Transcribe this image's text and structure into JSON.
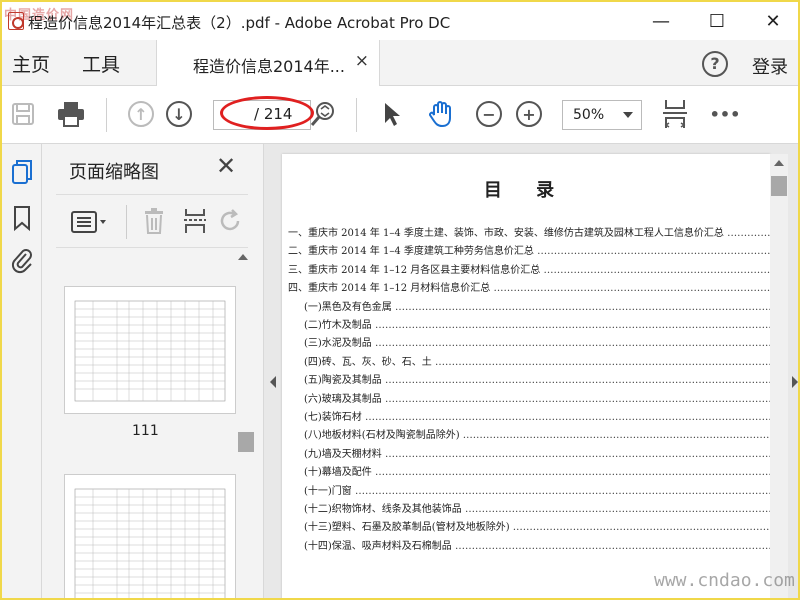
{
  "watermark_top": "中国造价网",
  "watermark_bottom": "www.cndao.com",
  "window": {
    "title": "程造价信息2014年汇总表（2）.pdf - Adobe Acrobat Pro DC",
    "minimize": "—",
    "maximize": "☐",
    "close": "✕"
  },
  "menubar": {
    "home": "主页",
    "tools": "工具",
    "tab_label": "程造价信息2014年...",
    "tab_close": "×",
    "help": "?",
    "login": "登录"
  },
  "toolbar": {
    "page_current": "",
    "page_total": "/ 214",
    "zoom": "50%",
    "more": "•••"
  },
  "thumbnails": {
    "title": "页面缩略图",
    "close": "✕",
    "page_labels": [
      "111"
    ]
  },
  "document": {
    "toc_title": "目 录",
    "toc_items": [
      {
        "text": "一、重庆市 2014 年 1–4 季度土建、装饰、市政、安装、维修仿古建筑及园林工程人工信息价汇总",
        "indent": false
      },
      {
        "text": "二、重庆市 2014 年 1–4 季度建筑工种劳务信息价汇总",
        "indent": false
      },
      {
        "text": "三、重庆市 2014 年 1–12 月各区县主要材料信息价汇总",
        "indent": false
      },
      {
        "text": "四、重庆市 2014 年 1–12 月材料信息价汇总",
        "indent": false
      },
      {
        "text": "(一)黑色及有色金属",
        "indent": true
      },
      {
        "text": "(二)竹木及制品",
        "indent": true
      },
      {
        "text": "(三)水泥及制品",
        "indent": true
      },
      {
        "text": "(四)砖、瓦、灰、砂、石、土",
        "indent": true
      },
      {
        "text": "(五)陶瓷及其制品",
        "indent": true
      },
      {
        "text": "(六)玻璃及其制品",
        "indent": true
      },
      {
        "text": "(七)装饰石材",
        "indent": true
      },
      {
        "text": "(八)地板材料(石材及陶瓷制品除外)",
        "indent": true
      },
      {
        "text": "(九)墙及天棚材料",
        "indent": true
      },
      {
        "text": "(十)幕墙及配件",
        "indent": true
      },
      {
        "text": "(十一)门窗",
        "indent": true
      },
      {
        "text": "(十二)织物饰材、线条及其他装饰品",
        "indent": true
      },
      {
        "text": "(十三)塑料、石墨及胶革制品(管材及地板除外)",
        "indent": true
      },
      {
        "text": "(十四)保温、吸声材料及石棉制品",
        "indent": true
      }
    ]
  },
  "colors": {
    "highlight_ellipse": "#e02020",
    "hand_tool": "#1a6fd1",
    "rail_active": "#1a6fd1"
  }
}
